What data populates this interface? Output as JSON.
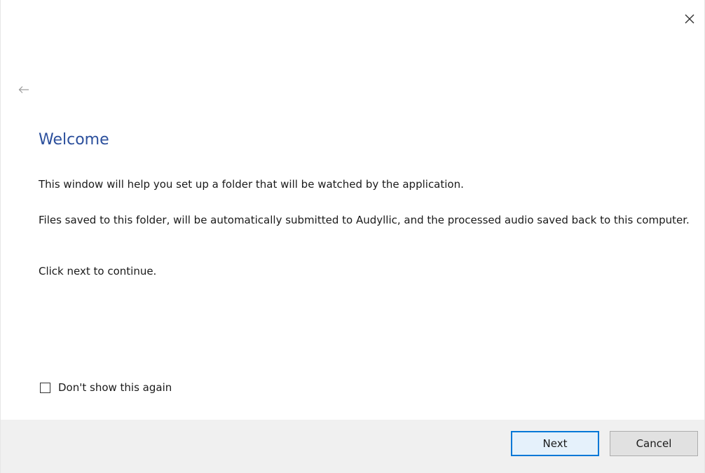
{
  "dialog": {
    "title": "Welcome",
    "paragraphs": [
      "This window will help you set up a folder that will be watched by the application.",
      "Files saved to this folder, will be automatically submitted to Audyllic, and the processed audio saved back to this computer.",
      "Click next to continue."
    ],
    "checkbox": {
      "label": "Don't show this again",
      "checked": false
    },
    "buttons": {
      "next_label": "Next",
      "cancel_label": "Cancel"
    },
    "icons": {
      "close": "close-icon",
      "back": "back-arrow-icon"
    },
    "colors": {
      "title": "#2b4f9c",
      "footer_background": "#f0f0f0",
      "default_button_border": "#0078d7"
    }
  }
}
